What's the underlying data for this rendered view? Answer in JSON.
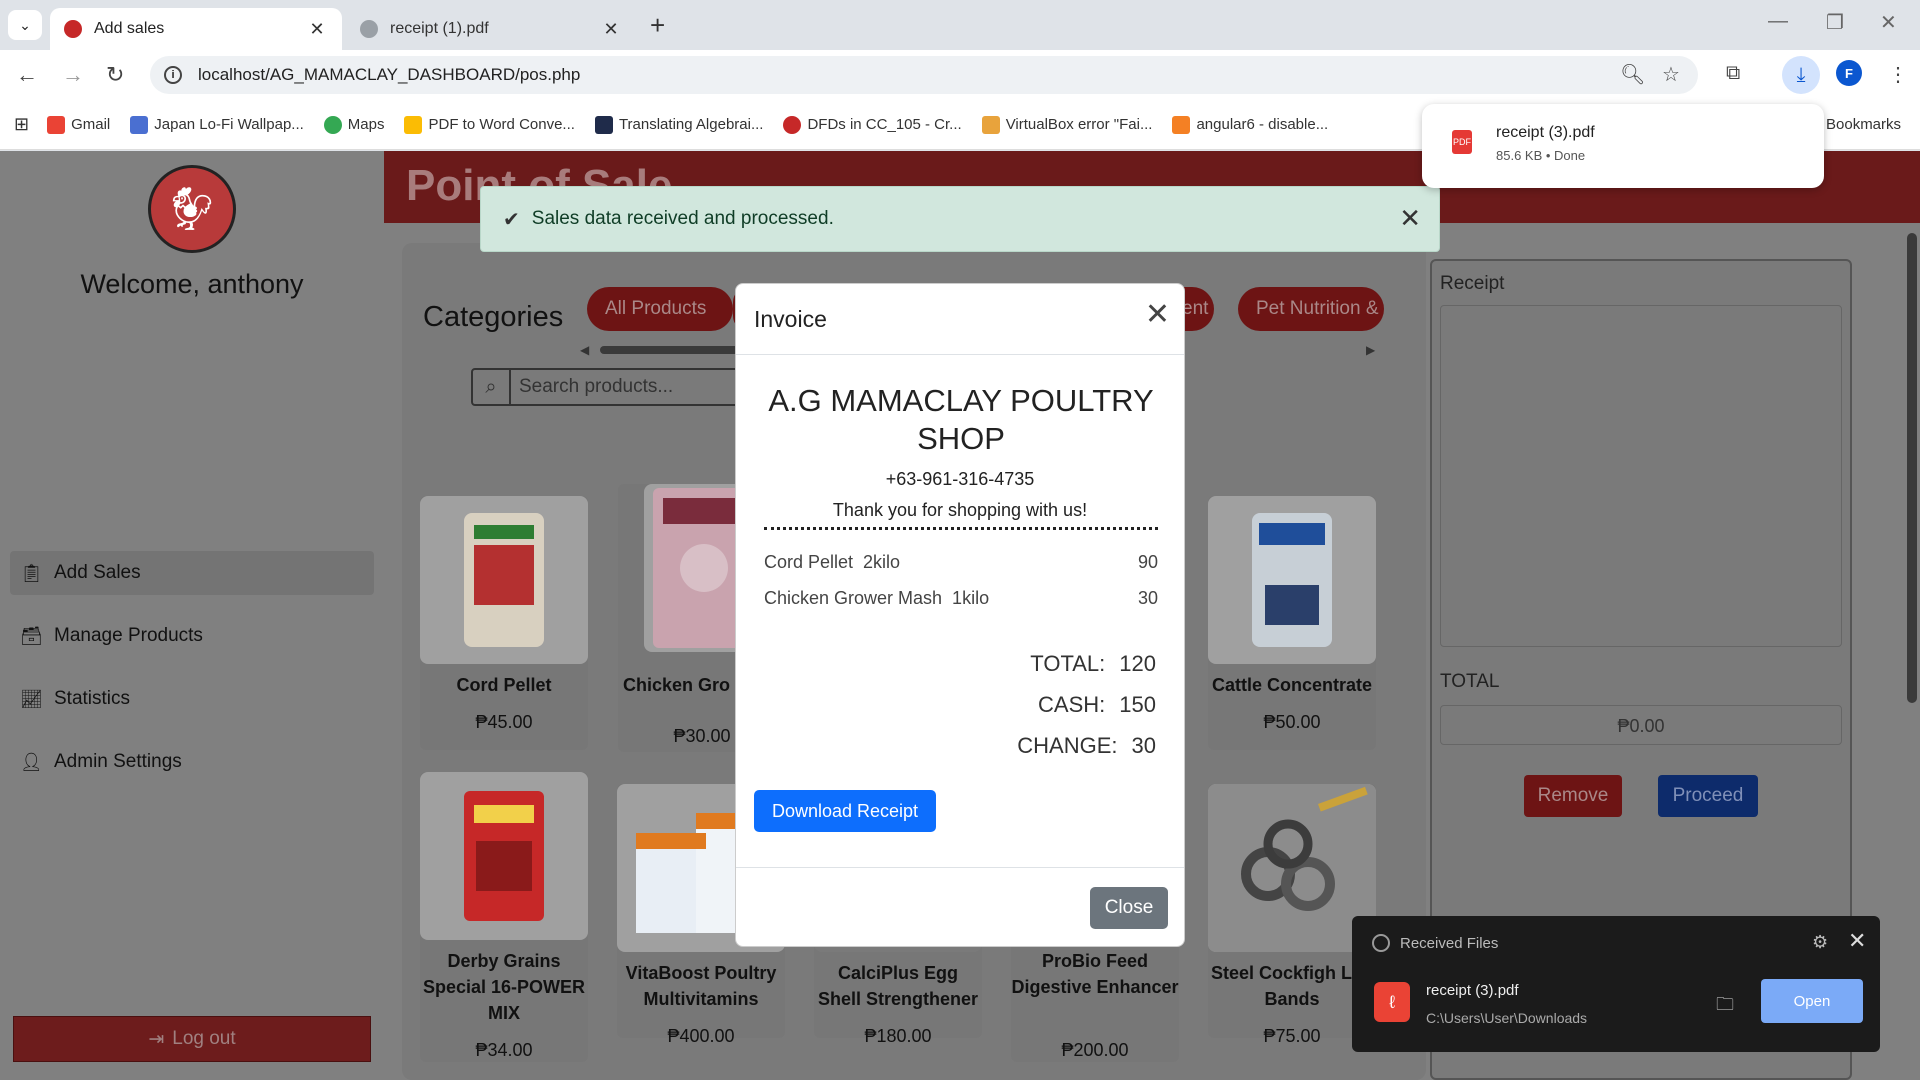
{
  "browser": {
    "tabs": [
      {
        "title": "Add sales",
        "active": true
      },
      {
        "title": "receipt (1).pdf",
        "active": false
      }
    ],
    "url": "localhost/AG_MAMACLAY_DASHBOARD/pos.php",
    "bookmarks": [
      "Gmail",
      "Japan Lo-Fi Wallpap...",
      "Maps",
      "PDF to Word Conve...",
      "Translating Algebrai...",
      "DFDs in CC_105 - Cr...",
      "VirtualBox error \"Fai...",
      "angular6 - disable..."
    ],
    "bookmarks_folder": "Bookmarks",
    "profile_initial": "F"
  },
  "download_bubble": {
    "file": "receipt (3).pdf",
    "meta": "85.6 KB • Done"
  },
  "sidebar": {
    "welcome": "Welcome, anthony",
    "items": [
      {
        "label": "Add Sales",
        "icon": "clipboard-icon",
        "active": true
      },
      {
        "label": "Manage Products",
        "icon": "archive-icon"
      },
      {
        "label": "Statistics",
        "icon": "chart-icon"
      },
      {
        "label": "Admin Settings",
        "icon": "user-icon"
      }
    ],
    "logout": "Log out"
  },
  "header": {
    "title": "Point of Sale"
  },
  "alert": {
    "message": "Sales data received and processed."
  },
  "categories": {
    "title": "Categories",
    "buttons": [
      "All Products",
      "ent",
      "Pet Nutrition &"
    ]
  },
  "search": {
    "placeholder": "Search products..."
  },
  "products": [
    {
      "name": "Cord Pellet",
      "price": "₱45.00"
    },
    {
      "name": "Chicken Gro Mash",
      "price": "₱30.00"
    },
    {
      "name": "Cattle Concentrate",
      "price": "₱50.00"
    },
    {
      "name": "Derby Grains Special 16-POWER MIX",
      "price": "₱34.00"
    },
    {
      "name": "VitaBoost Poultry Multivitamins",
      "price": "₱400.00"
    },
    {
      "name": "CalciPlus Egg Shell Strengthener",
      "price": "₱180.00"
    },
    {
      "name": "ProBio Feed Digestive Enhancer",
      "price": "₱200.00"
    },
    {
      "name": "Steel Cockfigh Leg Bands",
      "price": "₱75.00"
    }
  ],
  "receipt_panel": {
    "label": "Receipt",
    "total_label": "TOTAL",
    "total_value": "₱0.00",
    "remove": "Remove",
    "proceed": "Proceed"
  },
  "modal": {
    "title": "Invoice",
    "shop_name": "A.G MAMACLAY POULTRY SHOP",
    "phone": "+63-961-316-4735",
    "thanks": "Thank you for shopping with us!",
    "items": [
      {
        "desc": "Cord Pellet  2kilo",
        "amount": "90"
      },
      {
        "desc": "Chicken Grower Mash  1kilo",
        "amount": "30"
      }
    ],
    "total_label": "TOTAL:",
    "total": "120",
    "cash_label": "CASH:",
    "cash": "150",
    "change_label": "CHANGE:",
    "change": "30",
    "download": "Download Receipt",
    "close": "Close"
  },
  "received_files": {
    "title": "Received Files",
    "file": "receipt (3).pdf",
    "path": "C:\\Users\\User\\Downloads",
    "open": "Open"
  }
}
